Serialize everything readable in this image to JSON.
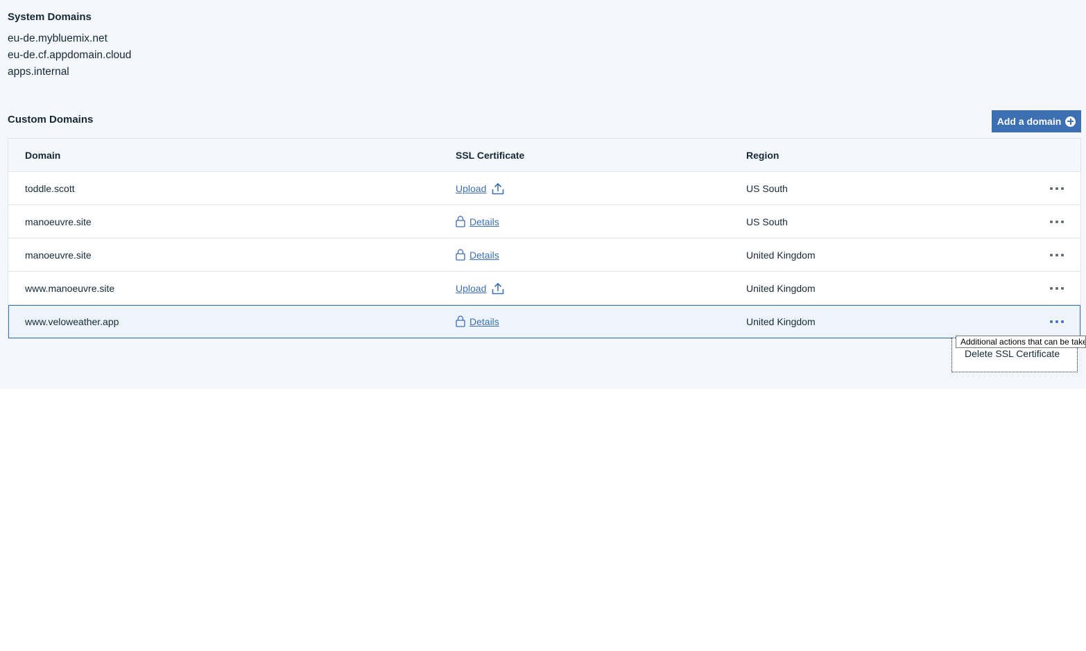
{
  "system_domains": {
    "title": "System Domains",
    "items": [
      "eu-de.mybluemix.net",
      "eu-de.cf.appdomain.cloud",
      "apps.internal"
    ]
  },
  "custom_domains": {
    "title": "Custom Domains",
    "add_button_label": "Add a domain",
    "columns": [
      "Domain",
      "SSL Certificate",
      "Region"
    ],
    "rows": [
      {
        "domain": "toddle.scott",
        "ssl": "Upload",
        "ssl_type": "upload",
        "region": "US South"
      },
      {
        "domain": "manoeuvre.site",
        "ssl": "Details",
        "ssl_type": "details",
        "region": "US South"
      },
      {
        "domain": "manoeuvre.site",
        "ssl": "Details",
        "ssl_type": "details",
        "region": "United Kingdom"
      },
      {
        "domain": "www.manoeuvre.site",
        "ssl": "Upload",
        "ssl_type": "upload",
        "region": "United Kingdom"
      },
      {
        "domain": "www.veloweather.app",
        "ssl": "Details",
        "ssl_type": "details",
        "region": "United Kingdom"
      }
    ]
  },
  "overflow_menu": {
    "tooltip": "Additional actions that can be take",
    "items": [
      "Delete SSL Certificate"
    ]
  },
  "colors": {
    "accent": "#3d70b2",
    "panel_bg": "#f4f7fb",
    "text": "#152935"
  }
}
